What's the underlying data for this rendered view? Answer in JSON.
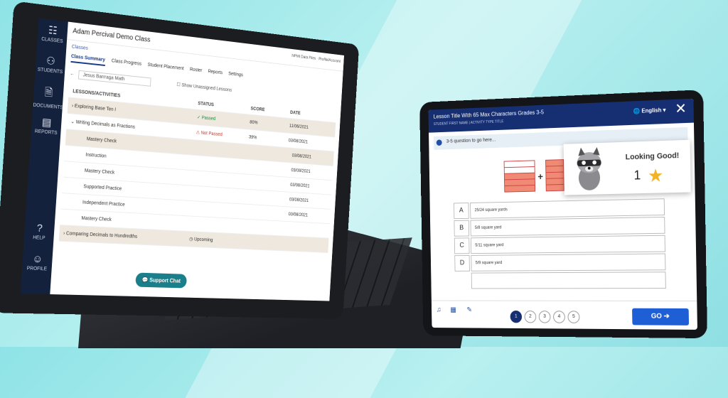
{
  "laptop": {
    "app_title": "Adam Percival Demo Class",
    "topbar_right": "NPMI Data Files · Profile/Account",
    "breadcrumb": "Classes",
    "sidebar": [
      {
        "label": "CLASSES",
        "icon": "classes-icon"
      },
      {
        "label": "STUDENTS",
        "icon": "students-icon"
      },
      {
        "label": "DOCUMENTS",
        "icon": "documents-icon"
      },
      {
        "label": "REPORTS",
        "icon": "reports-icon"
      }
    ],
    "sidebar_bottom": [
      {
        "label": "HELP",
        "icon": "help-icon"
      },
      {
        "label": "PROFILE",
        "icon": "profile-icon"
      }
    ],
    "tabs": [
      "Class Summary",
      "Class Progress",
      "Student Placement",
      "Roster",
      "Reports",
      "Settings"
    ],
    "student_select": "Jesus Barrraga",
    "subject": "Math",
    "show_unassigned": "Show Unassigned Lessons",
    "columns": [
      "LESSONS/ACTIVITIES",
      "STATUS",
      "SCORE",
      "DATE"
    ],
    "rows": [
      {
        "name": "Exploring Base Ten I",
        "status": "Passed",
        "score": "80%",
        "date": "11/06/2021"
      },
      {
        "name": "Writing Decimals as Fractions",
        "status": "Not Passed",
        "score": "39%",
        "date": "03/08/2021"
      },
      {
        "name": "Mastery Check",
        "status": "",
        "score": "",
        "date": "03/08/2021"
      },
      {
        "name": "Instruction",
        "status": "",
        "score": "",
        "date": "03/08/2021"
      },
      {
        "name": "Mastery Check",
        "status": "",
        "score": "",
        "date": "03/08/2021"
      },
      {
        "name": "Supported Practice",
        "status": "",
        "score": "",
        "date": "03/08/2021"
      },
      {
        "name": "Independent Practice",
        "status": "",
        "score": "",
        "date": "03/08/2021"
      },
      {
        "name": "Mastery Check",
        "status": "",
        "score": "",
        "date": ""
      },
      {
        "name": "Comparing Decimals to Hundredths",
        "status": "Upcoming",
        "score": "",
        "date": ""
      }
    ],
    "support_chat": "Support Chat"
  },
  "tablet": {
    "lesson_title": "Lesson Title With 65 Max Characters Grades 3-5",
    "subtitle": "STUDENT FIRST NAME | ACTIVITY TYPE TITLE",
    "language": "English",
    "question": "3-5 question to go here...",
    "feedback": "Looking Good!",
    "stars": "1",
    "options": [
      {
        "letter": "A",
        "text": "25/24 square yards"
      },
      {
        "letter": "B",
        "text": "5/8 square yard"
      },
      {
        "letter": "C",
        "text": "5/11 square yard"
      },
      {
        "letter": "D",
        "text": "5/9 square yard"
      }
    ],
    "pages": [
      "1",
      "2",
      "3",
      "4",
      "5"
    ],
    "current_page": "1",
    "go_label": "GO"
  },
  "colors": {
    "accent": "#162f73",
    "go": "#1f5fd6",
    "star": "#f4b324",
    "background": "#8fe3e6"
  }
}
